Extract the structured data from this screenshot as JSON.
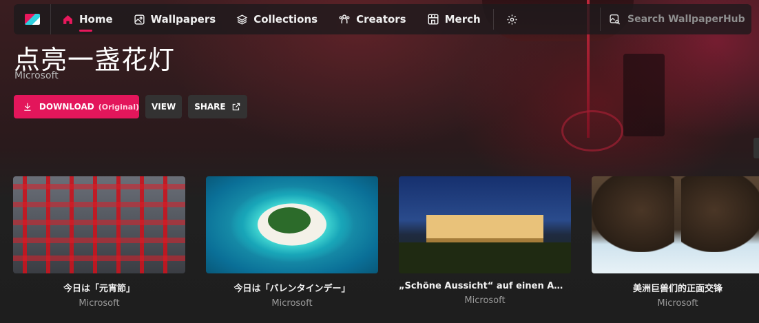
{
  "nav": {
    "items": [
      {
        "label": "Home",
        "icon": "home-icon",
        "active": true
      },
      {
        "label": "Wallpapers",
        "icon": "image-icon"
      },
      {
        "label": "Collections",
        "icon": "layers-icon"
      },
      {
        "label": "Creators",
        "icon": "people-icon"
      },
      {
        "label": "Merch",
        "icon": "store-icon"
      }
    ],
    "search_placeholder": "Search WallpaperHub",
    "accent": "#e8185c"
  },
  "hero": {
    "title": "点亮一盏花灯",
    "author": "Microsoft",
    "download_label": "DOWNLOAD",
    "download_sub": "(Original)",
    "view_label": "VIEW",
    "share_label": "SHARE"
  },
  "cards": [
    {
      "title": "今日は「元宵節」",
      "author": "Microsoft"
    },
    {
      "title": "今日は「バレンタインデー」",
      "author": "Microsoft"
    },
    {
      "title": "„Schöne Aussicht“ auf einen Amt...",
      "author": "Microsoft"
    },
    {
      "title": "美洲巨兽们的正面交锋",
      "author": "Microsoft"
    }
  ]
}
